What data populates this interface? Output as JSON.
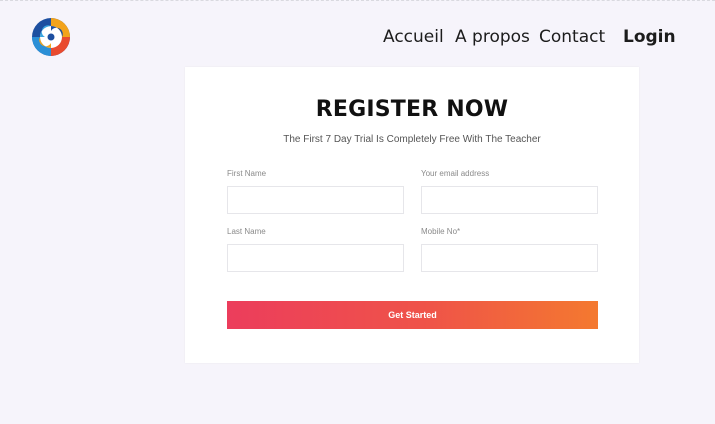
{
  "header": {
    "logo_icon": "circular-multicolor-logo",
    "nav": [
      "Accueil",
      "A propos",
      "Contact"
    ],
    "login_label": "Login"
  },
  "form": {
    "title": "REGISTER NOW",
    "subtitle": "The First 7 Day Trial Is Completely Free With The Teacher",
    "fields": {
      "first_name": {
        "label": "First Name",
        "value": ""
      },
      "email": {
        "label": "Your email address",
        "value": ""
      },
      "last_name": {
        "label": "Last Name",
        "value": ""
      },
      "mobile": {
        "label": "Mobile No*",
        "value": ""
      }
    },
    "submit_label": "Get Started"
  },
  "colors": {
    "background": "#f6f4fb",
    "gradient_start": "#ec3d5c",
    "gradient_end": "#f4792f"
  }
}
